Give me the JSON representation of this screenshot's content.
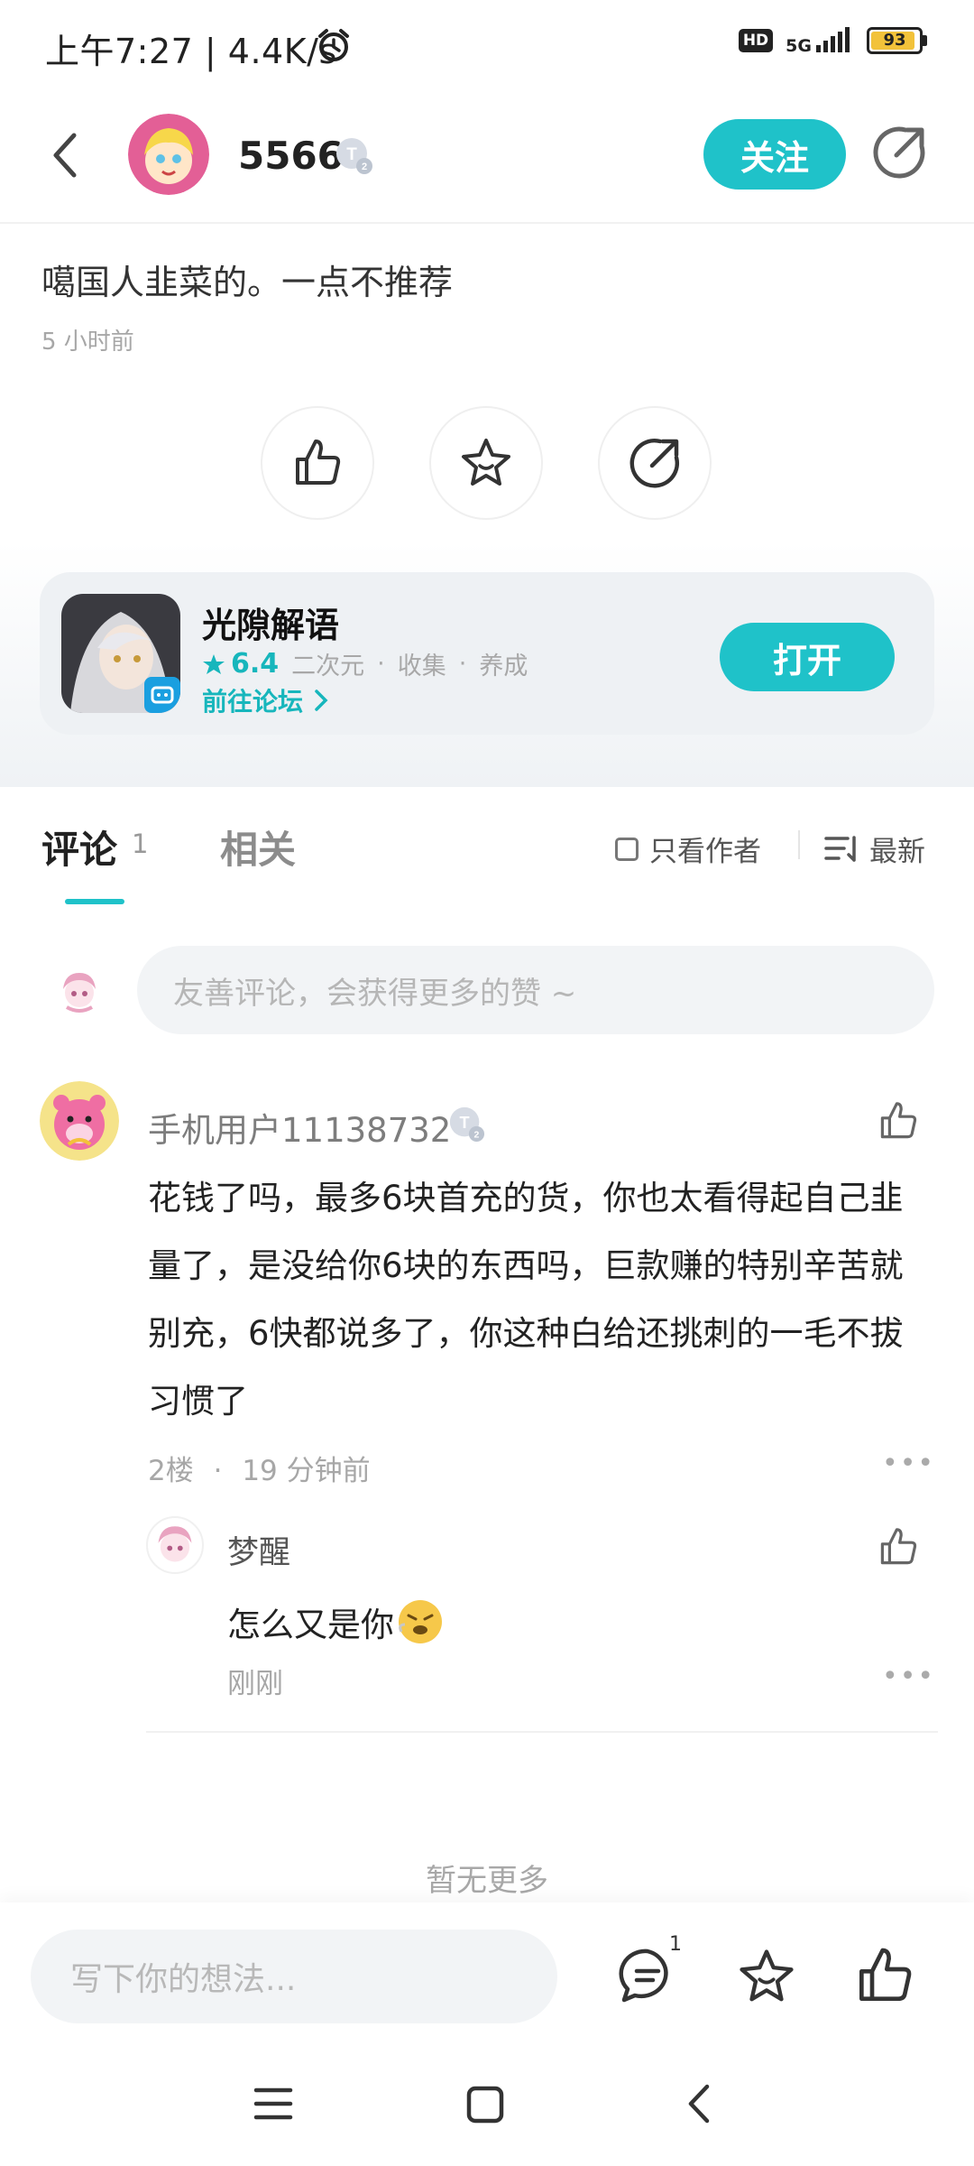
{
  "status_bar": {
    "time": "上午7:27 | 4.4K/s",
    "hd": "HD",
    "network": "5G",
    "battery": "93",
    "battery_level": 0.93
  },
  "header": {
    "username": "5566",
    "level_badge": "T2",
    "follow_label": "关注"
  },
  "post": {
    "text": "噶国人韭菜的。一点不推荐",
    "time": "5 小时前"
  },
  "game_card": {
    "name": "光隙解语",
    "score": "6.4",
    "tags": [
      "二次元",
      "收集",
      "养成"
    ],
    "forum_link": "前往论坛",
    "open_label": "打开"
  },
  "tabs": {
    "comment_label": "评论",
    "comment_count": "1",
    "related_label": "相关",
    "only_author_label": "只看作者",
    "sort_label": "最新"
  },
  "comment_input_placeholder": "友善评论，会获得更多的赞 ~",
  "comments": [
    {
      "username": "手机用户11138732",
      "level_badge": "T2",
      "body": "花钱了吗，最多6块首充的货，你也太看得起自己韭量了，是没给你6块的东西吗，巨款赚的特别辛苦就别充，6快都说多了，你这种白给还挑刺的一毛不拔习惯了",
      "floor": "2楼",
      "time": "19 分钟前",
      "reply": {
        "username": "梦醒",
        "body": "怎么又是你",
        "time": "刚刚"
      }
    }
  ],
  "footer": {
    "no_more": "暂无更多",
    "input_placeholder": "写下你的想法...",
    "comment_badge": "1"
  },
  "colors": {
    "accent": "#1fc2c9",
    "text_primary": "#222222",
    "text_muted": "#a7a7a7"
  }
}
